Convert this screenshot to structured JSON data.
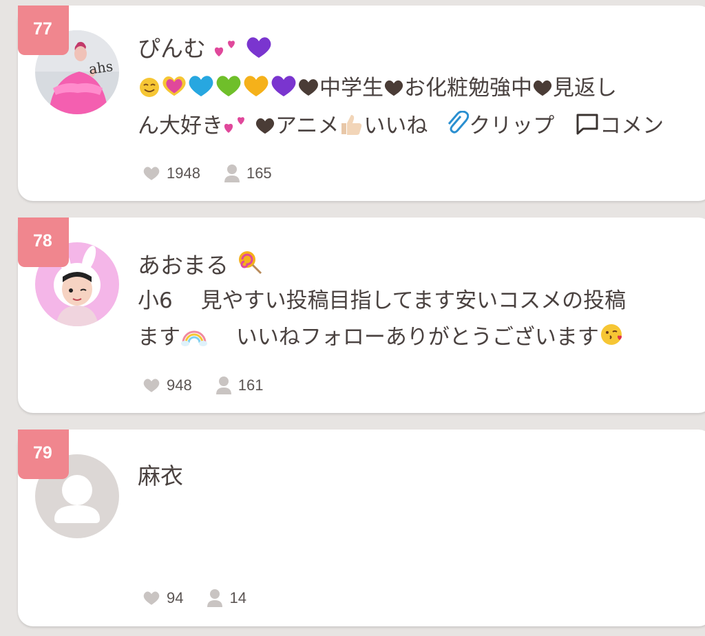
{
  "users": [
    {
      "rank": "77",
      "name": "ぴんむ",
      "bio_line1_a": "中学生",
      "bio_line1_b": "お化粧勉強中",
      "bio_line1_c": "見返し",
      "bio_line2_a": "ん大好き",
      "bio_line2_b": "アニメ",
      "bio_line2_c": "いいね",
      "bio_line2_d": "クリップ",
      "bio_line2_e": "コメン",
      "likes": "1948",
      "followers": "165"
    },
    {
      "rank": "78",
      "name": "あおまる",
      "bio_line1": "小6　 見やすい投稿目指してます安いコスメの投稿",
      "bio_line2_a": "ます",
      "bio_line2_b": "　 いいねフォローありがとうございます",
      "likes": "948",
      "followers": "161"
    },
    {
      "rank": "79",
      "name": "麻衣",
      "likes": "94",
      "followers": "14"
    }
  ],
  "colors": {
    "background": "#e7e4e2",
    "rank_badge": "#f0868e",
    "text": "#4a4240",
    "stat_icon": "#c9c4c2"
  },
  "icons": {
    "like": "heart-icon",
    "follower": "person-icon"
  }
}
